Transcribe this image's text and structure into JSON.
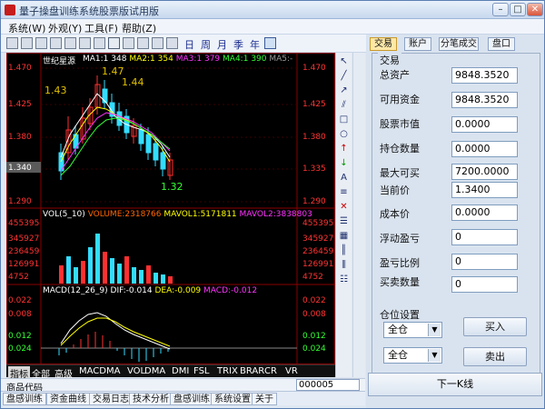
{
  "window": {
    "title": "量子操盘训练系统股票版试用版"
  },
  "menu": [
    "系统(W)",
    "外观(Y)",
    "工具(F)",
    "帮助(Z)"
  ],
  "periods": [
    "日",
    "周",
    "月",
    "季",
    "年"
  ],
  "chart": {
    "stock_name": "世纪星源",
    "ma_labels": [
      {
        "label": "MA1:1",
        "value": "348",
        "color": "#ffffff"
      },
      {
        "label": "MA2:1",
        "value": "354",
        "color": "#ffff00"
      },
      {
        "label": "MA3:1",
        "value": "379",
        "color": "#ff33ff"
      },
      {
        "label": "MA4:1",
        "value": "390",
        "color": "#33ff33"
      },
      {
        "label": "MA5:-",
        "value": "",
        "color": "#999999"
      }
    ],
    "price_axis_left": [
      "1.470",
      "1.425",
      "1.380",
      "1.340",
      "1.290"
    ],
    "price_axis_right": [
      "1.470",
      "1.425",
      "1.380",
      "1.335",
      "1.290"
    ],
    "annotations": [
      "1.47",
      "1.43",
      "1.44",
      "1.32"
    ],
    "volume_legend": {
      "name": "VOL(5_10)",
      "volume": "VOLUME:2318766",
      "mavol1": "MAVOL1:5171811",
      "mavol2": "MAVOL2:3838803"
    },
    "volume_axis": [
      "455395",
      "345927",
      "236459",
      "126991",
      "4752"
    ],
    "macd_legend": {
      "name": "MACD(12_26_9)",
      "dif": "DIF:-0.014",
      "dea": "DEA:-0.009",
      "macd": "MACD:-0.012"
    },
    "macd_axis": [
      "0.022",
      "0.008",
      "0.012",
      "0.024"
    ]
  },
  "indicator_tabs": [
    "指标",
    "全部",
    "高级",
    "MACD",
    "MA",
    "VOL",
    "DMA",
    "DMI",
    "FSL",
    "TRIX",
    "BRAR",
    "CR",
    "VR"
  ],
  "code_bar": {
    "label": "商品代码",
    "code": "000005"
  },
  "bottom_tabs": [
    "盘感训练",
    "资金曲线",
    "交易日志",
    "技术分析",
    "盘感训练",
    "系统设置",
    "关于"
  ],
  "right_tabs": [
    "交易",
    "账户",
    "分笔成交",
    "盘口"
  ],
  "trade": {
    "group_label": "交易",
    "fields": [
      {
        "label": "总资产",
        "value": "9848.3520"
      },
      {
        "label": "可用资金",
        "value": "9848.3520"
      },
      {
        "label": "股票市值",
        "value": "0.0000"
      },
      {
        "label": "持仓数量",
        "value": "0.0000"
      },
      {
        "label": "最大可买",
        "value": "7200.0000"
      },
      {
        "label": "当前价",
        "value": "1.3400"
      },
      {
        "label": "成本价",
        "value": "0.0000"
      },
      {
        "label": "浮动盈亏",
        "value": "0"
      },
      {
        "label": "盈亏比例",
        "value": "0"
      },
      {
        "label": "买卖数量",
        "value": "0"
      }
    ],
    "position_label": "仓位设置",
    "buy_select": "全仓",
    "sell_select": "全仓",
    "buy_button": "买入",
    "sell_button": "卖出",
    "next_line_button": "下一K线"
  }
}
